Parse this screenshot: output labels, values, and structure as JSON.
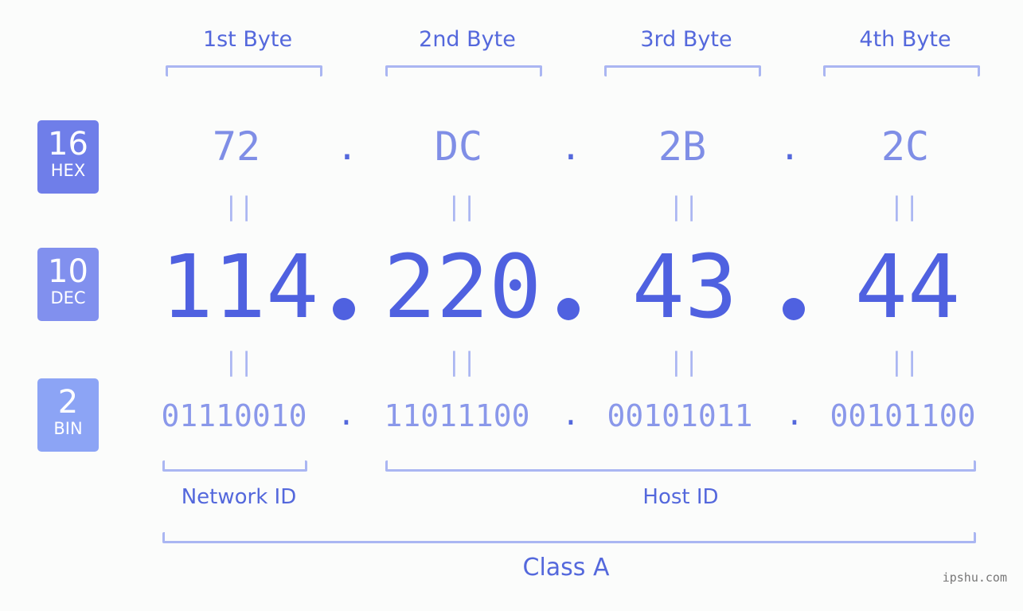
{
  "bytes": [
    {
      "label": "1st Byte",
      "hex": "72",
      "dec": "114",
      "bin": "01110010"
    },
    {
      "label": "2nd Byte",
      "hex": "DC",
      "dec": "220",
      "bin": "11011100"
    },
    {
      "label": "3rd Byte",
      "hex": "2B",
      "dec": "43",
      "bin": "00101011"
    },
    {
      "label": "4th Byte",
      "hex": "2C",
      "dec": "44",
      "bin": "00101100"
    }
  ],
  "separator": ".",
  "equals": "||",
  "badges": {
    "hex": {
      "number": "16",
      "label": "HEX",
      "color": "#6f7ee9"
    },
    "dec": {
      "number": "10",
      "label": "DEC",
      "color": "#8190ee"
    },
    "bin": {
      "number": "2",
      "label": "BIN",
      "color": "#8ca4f5"
    }
  },
  "network_id_label": "Network ID",
  "host_id_label": "Host ID",
  "class_label": "Class A",
  "watermark": "ipshu.com"
}
